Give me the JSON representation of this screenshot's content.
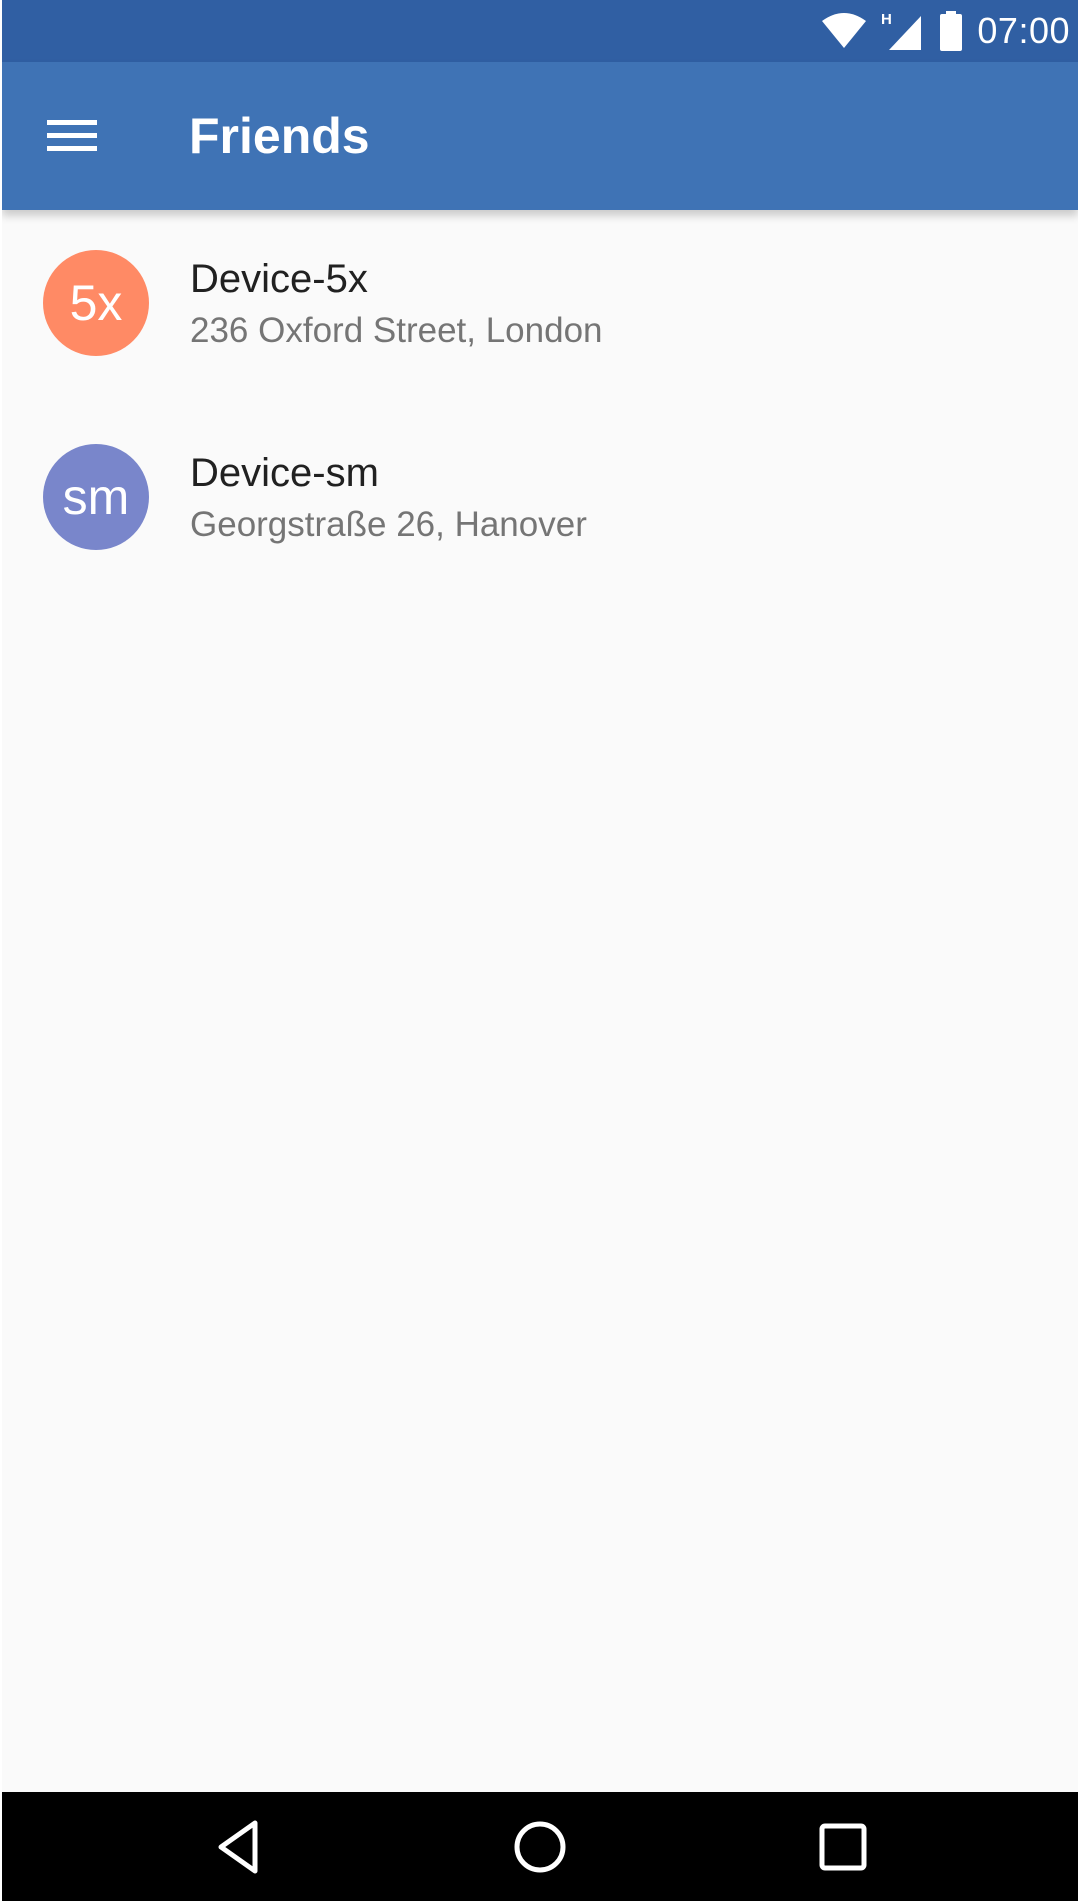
{
  "status_bar": {
    "time": "07:00",
    "network_type": "H",
    "icons": [
      "wifi-icon",
      "cell-signal-icon",
      "battery-icon"
    ]
  },
  "app_bar": {
    "title": "Friends",
    "menu_icon": "hamburger-menu-icon"
  },
  "friends": [
    {
      "initials": "5x",
      "name": "Device-5x",
      "address": "236 Oxford Street, London",
      "avatar_color": "#ff8a65"
    },
    {
      "initials": "sm",
      "name": "Device-sm",
      "address": "Georgstraße 26, Hanover",
      "avatar_color": "#7986cb"
    }
  ],
  "nav_bar": {
    "buttons": [
      "back-icon",
      "home-icon",
      "recents-icon"
    ]
  },
  "colors": {
    "status_bar": "#305fa3",
    "app_bar": "#3f73b5",
    "background": "#fafafa",
    "nav_bar": "#000000"
  }
}
